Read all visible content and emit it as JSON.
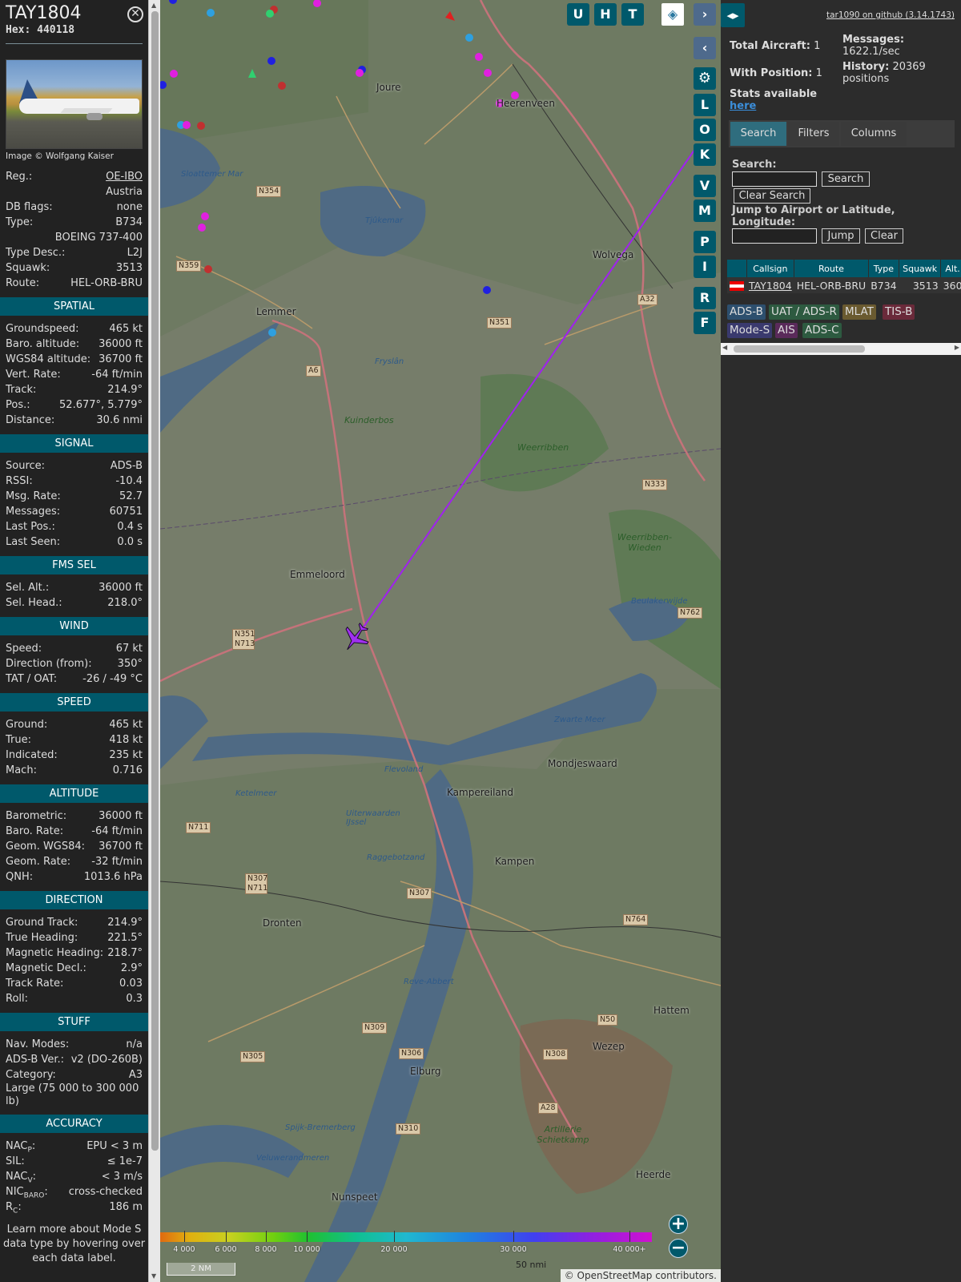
{
  "info": {
    "callsign": "TAY1804",
    "hex_label": "Hex:",
    "hex": "440118",
    "photo_credit": "Image © Wolfgang Kaiser",
    "basic": [
      {
        "k": "Reg.:",
        "v": "OE-IBO"
      },
      {
        "k": "",
        "v": "Austria"
      },
      {
        "k": "DB flags:",
        "v": "none"
      },
      {
        "k": "Type:",
        "v": "B734"
      },
      {
        "k": "",
        "v": "BOEING 737-400"
      },
      {
        "k": "Type Desc.:",
        "v": "L2J"
      },
      {
        "k": "Squawk:",
        "v": "3513"
      },
      {
        "k": "Route:",
        "v": "HEL-ORB-BRU"
      }
    ],
    "sections": {
      "spatial": {
        "title": "SPATIAL",
        "rows": [
          {
            "k": "Groundspeed:",
            "v": "465 kt"
          },
          {
            "k": "Baro. altitude:",
            "v": "36000 ft"
          },
          {
            "k": "WGS84 altitude:",
            "v": "36700 ft"
          },
          {
            "k": "Vert. Rate:",
            "v": "-64 ft/min"
          },
          {
            "k": "Track:",
            "v": "214.9°"
          },
          {
            "k": "Pos.:",
            "v": "52.677°, 5.779°"
          },
          {
            "k": "Distance:",
            "v": "30.6 nmi"
          }
        ]
      },
      "signal": {
        "title": "SIGNAL",
        "rows": [
          {
            "k": "Source:",
            "v": "ADS-B"
          },
          {
            "k": "RSSI:",
            "v": "-10.4"
          },
          {
            "k": "Msg. Rate:",
            "v": "52.7"
          },
          {
            "k": "Messages:",
            "v": "60751"
          },
          {
            "k": "Last Pos.:",
            "v": "0.4 s"
          },
          {
            "k": "Last Seen:",
            "v": "0.0 s"
          }
        ]
      },
      "fms": {
        "title": "FMS SEL",
        "rows": [
          {
            "k": "Sel. Alt.:",
            "v": "36000 ft"
          },
          {
            "k": "Sel. Head.:",
            "v": "218.0°"
          }
        ]
      },
      "wind": {
        "title": "WIND",
        "rows": [
          {
            "k": "Speed:",
            "v": "67 kt"
          },
          {
            "k": "Direction (from):",
            "v": "350°"
          },
          {
            "k": "TAT / OAT:",
            "v": "-26 / -49 °C"
          }
        ]
      },
      "speed": {
        "title": "SPEED",
        "rows": [
          {
            "k": "Ground:",
            "v": "465 kt"
          },
          {
            "k": "True:",
            "v": "418 kt"
          },
          {
            "k": "Indicated:",
            "v": "235 kt"
          },
          {
            "k": "Mach:",
            "v": "0.716"
          }
        ]
      },
      "altitude": {
        "title": "ALTITUDE",
        "rows": [
          {
            "k": "Barometric:",
            "v": "36000 ft"
          },
          {
            "k": "Baro. Rate:",
            "v": "-64 ft/min"
          },
          {
            "k": "Geom. WGS84:",
            "v": "36700 ft"
          },
          {
            "k": "Geom. Rate:",
            "v": "-32 ft/min"
          },
          {
            "k": "QNH:",
            "v": "1013.6 hPa"
          }
        ]
      },
      "direction": {
        "title": "DIRECTION",
        "rows": [
          {
            "k": "Ground Track:",
            "v": "214.9°"
          },
          {
            "k": "True Heading:",
            "v": "221.5°"
          },
          {
            "k": "Magnetic Heading:",
            "v": "218.7°"
          },
          {
            "k": "Magnetic Decl.:",
            "v": "2.9°"
          },
          {
            "k": "Track Rate:",
            "v": "0.03"
          },
          {
            "k": "Roll:",
            "v": "0.3"
          }
        ]
      },
      "stuff": {
        "title": "STUFF",
        "rows": [
          {
            "k": "Nav. Modes:",
            "v": "n/a"
          },
          {
            "k": "ADS-B Ver.:",
            "v": "v2 (DO-260B)"
          },
          {
            "k": "Category:",
            "v": "A3"
          }
        ],
        "category_desc": "Large (75 000 to 300 000 lb)"
      },
      "accuracy": {
        "title": "ACCURACY",
        "rows": [
          {
            "k": "NAC",
            "sub": "P",
            "v": "EPU < 3 m"
          },
          {
            "k": "SIL:",
            "sub": "",
            "v": "≤ 1e-7"
          },
          {
            "k": "NAC",
            "sub": "V",
            "v": "< 3 m/s"
          },
          {
            "k": "NIC",
            "sub": "BARO",
            "v": "cross-checked"
          },
          {
            "k": "R",
            "sub": "C",
            "v": "186 m"
          }
        ]
      }
    },
    "footnote": "Learn more about Mode S data type by hovering over each data label."
  },
  "map": {
    "buttons": [
      "U",
      "H",
      "T"
    ],
    "side_buttons": [
      "L",
      "O",
      "K",
      "V",
      "M",
      "P",
      "I",
      "R",
      "F"
    ],
    "towns": [
      "Joure",
      "Heerenveen",
      "Lemmer",
      "Wolvega",
      "Emmeloord",
      "Kampereiland",
      "Kampen",
      "Dronten",
      "Elburg",
      "Wezep",
      "Hattem",
      "Heerde",
      "Nunspeet",
      "Mondjeswaard"
    ],
    "waters": [
      "Sloattemer Mar",
      "Tjûkemar",
      "Ketelmeer",
      "Uiterwaarden IJssel",
      "Zwarte Meer",
      "Veluwerandmeren",
      "Beulakerwijde",
      "Raggebotzand",
      "Reve-Abbert",
      "Spijk-Bremerberg",
      "Flevoland",
      "Fryslân"
    ],
    "nature": [
      "Kuinderbos",
      "Weerribben",
      "Weerribben-Wieden",
      "Artillerie Schietkamp"
    ],
    "roads": [
      "N354",
      "N359",
      "A6",
      "N351",
      "N333",
      "A32",
      "N762",
      "N351 N713",
      "N711",
      "N307 N711",
      "N307",
      "N764",
      "N50",
      "N309",
      "N306",
      "N308",
      "N305",
      "N310",
      "A28"
    ],
    "legend_ticks": [
      "4 000",
      "6 000",
      "8 000",
      "10 000",
      "20 000",
      "30 000",
      "40 000+"
    ],
    "scale": "2 NM",
    "scale2": "50 nmi",
    "attribution": "© OpenStreetMap contributors.",
    "zoom_in": "+",
    "zoom_out": "−",
    "colors": {
      "track": "#a020f0",
      "aircraft": "#a030f0",
      "accent": "#00596b"
    }
  },
  "sidebar": {
    "version": "tar1090 on github (3.14.1743)",
    "total_aircraft_label": "Total Aircraft:",
    "total_aircraft": "1",
    "with_position_label": "With Position:",
    "with_position": "1",
    "stats_label": "Stats available",
    "stats_link": "here",
    "messages_label": "Messages:",
    "messages": "1622.1/sec",
    "history_label": "History:",
    "history": "20369 positions",
    "tabs": [
      "Search",
      "Filters",
      "Columns"
    ],
    "search_label": "Search:",
    "search_button": "Search",
    "clear_search_button": "Clear Search",
    "jump_label": "Jump to Airport or Latitude, Longitude:",
    "jump_button": "Jump",
    "clear_button": "Clear",
    "table": {
      "headers": [
        "",
        "Callsign",
        "Route",
        "Type",
        "Squawk",
        "Alt."
      ],
      "row": {
        "callsign": "TAY1804",
        "route": "HEL-ORB-BRU",
        "type": "B734",
        "squawk": "3513",
        "alt": "360"
      }
    },
    "chips": [
      {
        "label": "ADS-B",
        "color": "#2d4f6e"
      },
      {
        "label": "UAT / ADS-R",
        "color": "#2d5a40"
      },
      {
        "label": "MLAT",
        "color": "#6a5a30"
      },
      {
        "label": "TIS-B",
        "color": "#6a2a3a"
      },
      {
        "label": "Mode-S",
        "color": "#3a3a6e"
      },
      {
        "label": "AIS",
        "color": "#5a2a5a"
      },
      {
        "label": "ADS-C",
        "color": "#2d5a40"
      }
    ]
  }
}
